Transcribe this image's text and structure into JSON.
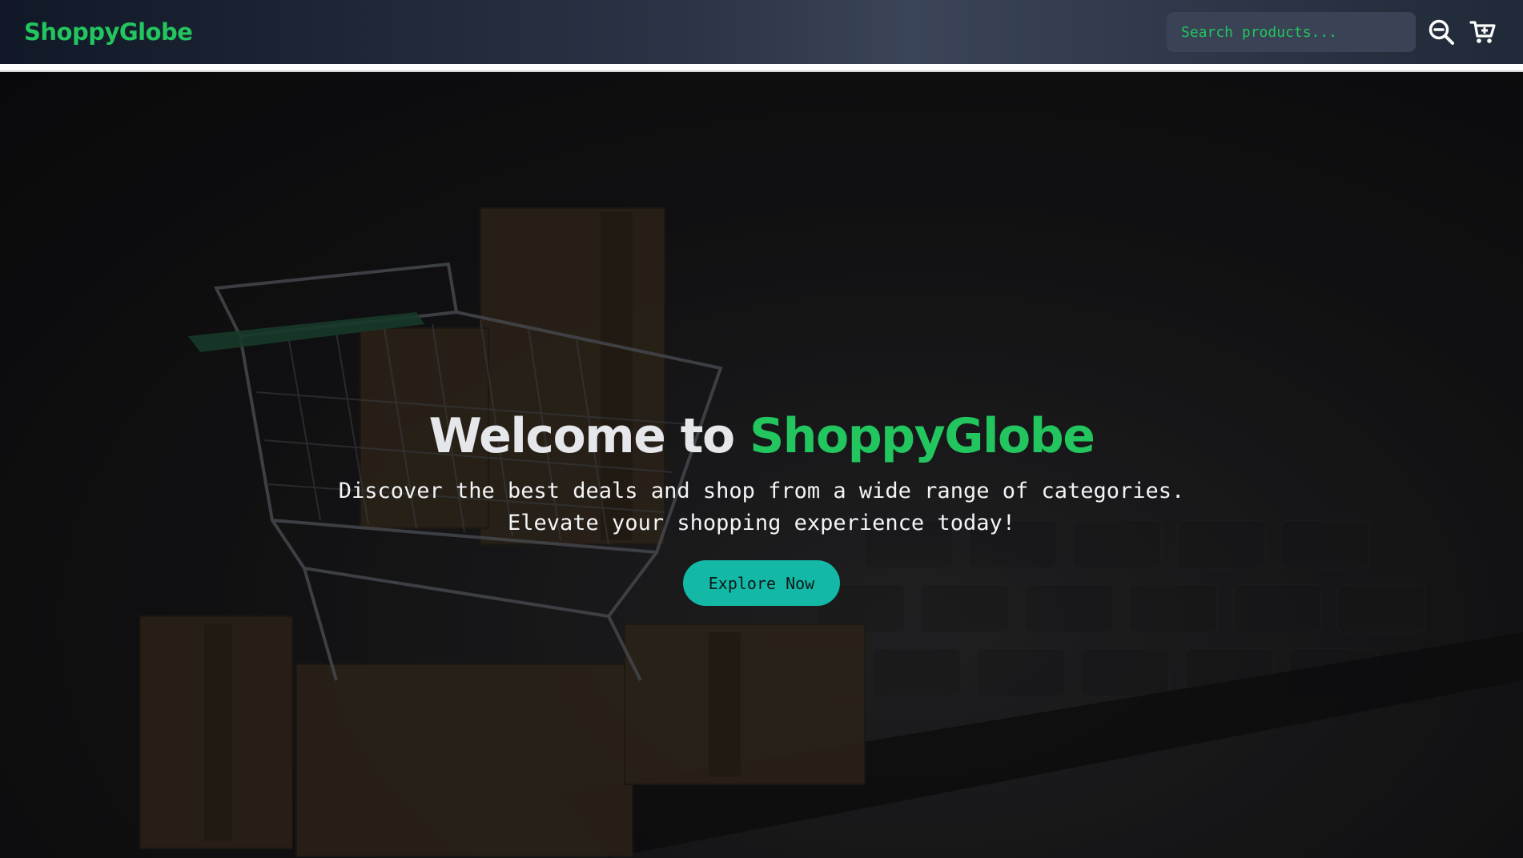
{
  "header": {
    "logo": "ShoppyGlobe",
    "search": {
      "placeholder": "Search products...",
      "value": ""
    },
    "icons": {
      "search": "search-minus-icon",
      "cart": "cart-icon"
    }
  },
  "hero": {
    "title_prefix": "Welcome to ",
    "title_brand": "ShoppyGlobe",
    "subtitle_line1": "Discover the best deals and shop from a wide range of categories.",
    "subtitle_line2": "Elevate your shopping experience today!",
    "cta_label": "Explore Now"
  },
  "colors": {
    "brand": "#22c55e",
    "cta": "#14b8a6",
    "nav_start": "#111827",
    "nav_mid": "#3b4458"
  }
}
